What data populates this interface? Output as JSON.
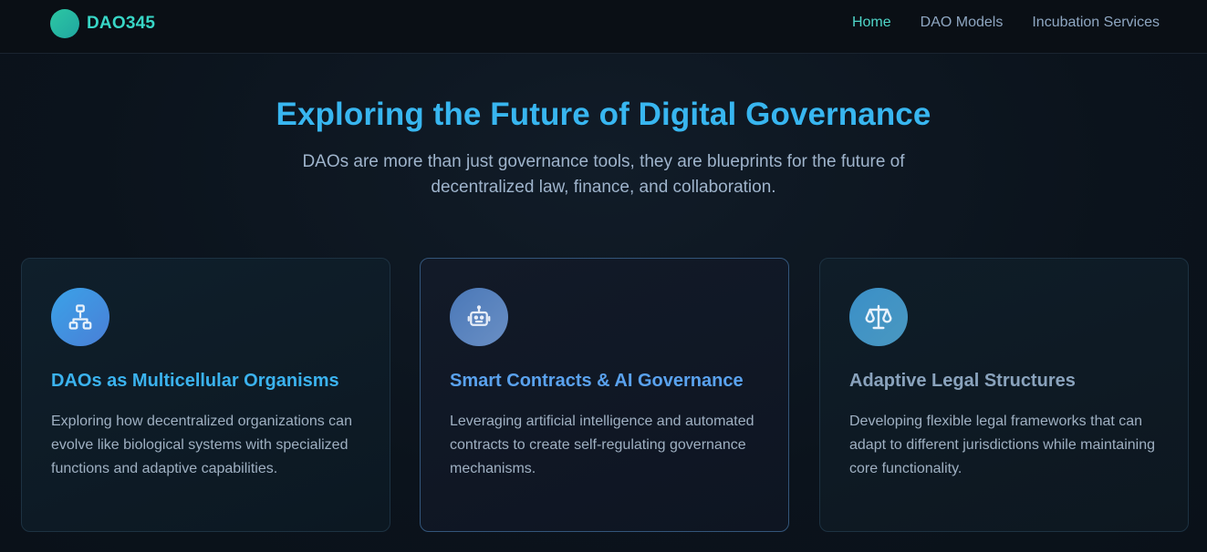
{
  "brand": {
    "name": "DAO345"
  },
  "nav": {
    "items": [
      {
        "label": "Home",
        "active": true
      },
      {
        "label": "DAO Models",
        "active": false
      },
      {
        "label": "Incubation Services",
        "active": false
      }
    ]
  },
  "hero": {
    "title": "Exploring the Future of Digital Governance",
    "subtitle": "DAOs are more than just governance tools, they are blueprints for the future of decentralized law, finance, and collaboration."
  },
  "cards": [
    {
      "icon": "network-hierarchy-icon",
      "title": "DAOs as Multicellular Organisms",
      "description": "Exploring how decentralized organizations can evolve like biological systems with specialized functions and adaptive capabilities."
    },
    {
      "icon": "robot-icon",
      "title": "Smart Contracts & AI Governance",
      "description": "Leveraging artificial intelligence and automated contracts to create self-regulating governance mechanisms."
    },
    {
      "icon": "scales-icon",
      "title": "Adaptive Legal Structures",
      "description": "Developing flexible legal frameworks that can adapt to different jurisdictions while maintaining core functionality."
    }
  ],
  "colors": {
    "accent": "#38b6f0",
    "brand": "#38d6c6",
    "nav_active": "#4fd6c9",
    "background": "#0b121b"
  }
}
